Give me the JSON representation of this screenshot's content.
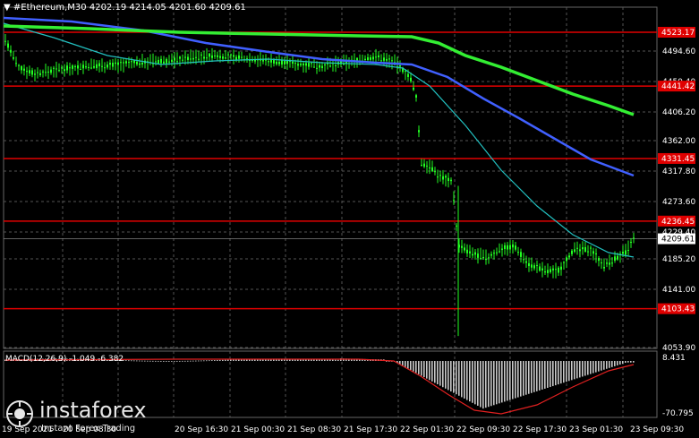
{
  "header": {
    "symbol": "#Ethereum,M30",
    "ohlc": "4202.19 4214.05 4201.60 4209.61"
  },
  "macd": {
    "label": "MACD(12,26,9) -1.049 -6.382"
  },
  "brand": {
    "name": "instaforex",
    "tagline": "Instant Forex Trading"
  },
  "price_axis": [
    "4494.60",
    "4450.40",
    "4406.20",
    "4362.00",
    "4317.80",
    "4273.60",
    "4229.40",
    "4185.20",
    "4141.00",
    "4053.90"
  ],
  "macd_axis": [
    "8.431",
    "-70.795"
  ],
  "levels": [
    {
      "price": "4523.17"
    },
    {
      "price": "4441.42"
    },
    {
      "price": "4331.45"
    },
    {
      "price": "4236.45"
    },
    {
      "price": "4103.43"
    }
  ],
  "current_price": "4209.61",
  "time_axis": [
    "19 Sep 2021",
    "20 Sep 08:30",
    "20 Sep 16:30",
    "21 Sep 00:30",
    "21 Sep 08:30",
    "21 Sep 17:30",
    "22 Sep 01:30",
    "22 Sep 09:30",
    "22 Sep 17:30",
    "23 Sep 01:30",
    "23 Sep 09:30"
  ],
  "colors": {
    "background": "#000000",
    "level": "#e00000",
    "ma_fast": "#22c0c0",
    "ma_mid": "#4060ff",
    "ma_slow": "#33ee33",
    "candle": "#22ff22",
    "hist": "#c8c8c8",
    "signal": "#e02020"
  },
  "icons": {
    "brand": "instaforex-logo-icon",
    "dropdown": "triangle-down-icon"
  }
}
